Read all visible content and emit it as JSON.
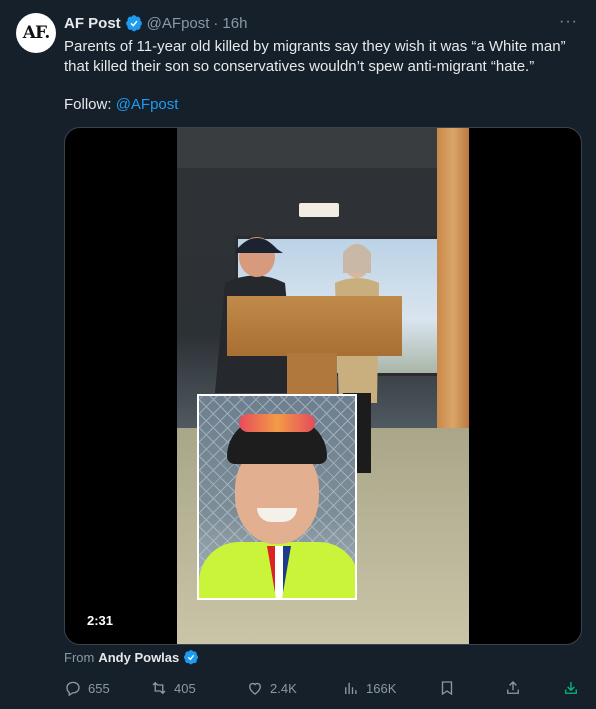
{
  "post": {
    "avatar_text": "AF.",
    "author_name": "AF Post",
    "handle": "@AFpost",
    "separator": "·",
    "time": "16h",
    "more_label": "···",
    "text": "Parents of 11-year old killed by migrants say they wish it was “a White man” that killed their son so conservatives wouldn’t spew anti-migrant “hate.”",
    "follow_label": "Follow: ",
    "follow_link": "@AFpost"
  },
  "media": {
    "duration": "2:31"
  },
  "attribution": {
    "prefix": "From",
    "source": "Andy Powlas"
  },
  "actions": {
    "replies": "655",
    "reposts": "405",
    "likes": "2.4K",
    "views": "166K"
  },
  "colors": {
    "background": "#15202b",
    "accent": "#1d9bf0",
    "muted_text": "#8b98a5"
  }
}
